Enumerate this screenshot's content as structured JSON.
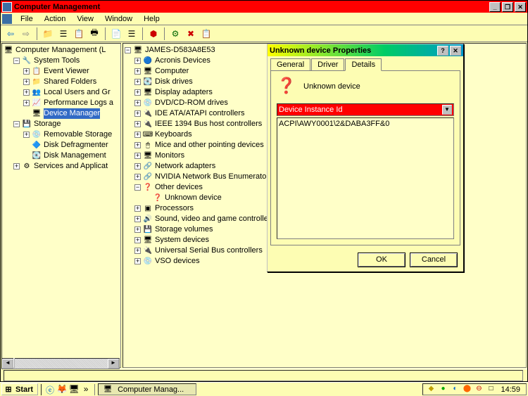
{
  "window": {
    "title": "Computer Management"
  },
  "menu": {
    "file": "File",
    "action": "Action",
    "view": "View",
    "window": "Window",
    "help": "Help"
  },
  "left_tree": {
    "root": "Computer Management (L",
    "system_tools": "System Tools",
    "event_viewer": "Event Viewer",
    "shared_folders": "Shared Folders",
    "local_users": "Local Users and Gr",
    "perf_logs": "Performance Logs a",
    "device_manager": "Device Manager",
    "storage": "Storage",
    "removable": "Removable Storage",
    "defrag": "Disk Defragmenter",
    "diskmgmt": "Disk Management",
    "services": "Services and Applicat"
  },
  "right_tree": {
    "root": "JAMES-D583A8E53",
    "acronis": "Acronis Devices",
    "computer": "Computer",
    "disk_drives": "Disk drives",
    "display": "Display adapters",
    "dvd": "DVD/CD-ROM drives",
    "ide": "IDE ATA/ATAPI controllers",
    "ieee": "IEEE 1394 Bus host controllers",
    "keyboards": "Keyboards",
    "mice": "Mice and other pointing devices",
    "monitors": "Monitors",
    "network": "Network adapters",
    "nvidia": "NVIDIA Network Bus Enumerator",
    "other": "Other devices",
    "unknown": "Unknown device",
    "processors": "Processors",
    "sound": "Sound, video and game controllers",
    "volumes": "Storage volumes",
    "sysdev": "System devices",
    "usb": "Universal Serial Bus controllers",
    "vso": "VSO devices"
  },
  "dialog": {
    "title": "Unknown device Properties",
    "tab_general": "General",
    "tab_driver": "Driver",
    "tab_details": "Details",
    "device_name": "Unknown device",
    "combo_label": "Device Instance Id",
    "instance_id": "ACPI\\AWY0001\\2&DABA3FF&0",
    "ok": "OK",
    "cancel": "Cancel"
  },
  "taskbar": {
    "start": "Start",
    "task1": "Computer Manag...",
    "clock": "14:59"
  }
}
